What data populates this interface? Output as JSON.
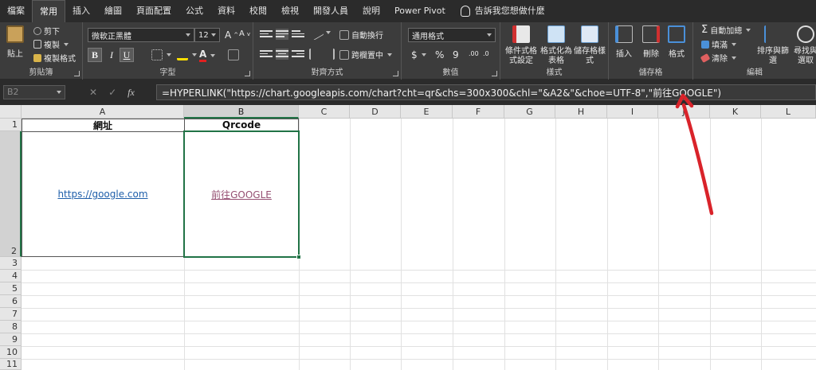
{
  "tabs": [
    "檔案",
    "常用",
    "插入",
    "繪圖",
    "頁面配置",
    "公式",
    "資料",
    "校閱",
    "檢視",
    "開發人員",
    "說明",
    "Power Pivot"
  ],
  "active_tab": "常用",
  "tell_me": "告訴我您想做什麼",
  "ribbon": {
    "clipboard": {
      "label": "剪貼簿",
      "paste": "貼上",
      "cut": "剪下",
      "copy": "複製",
      "format_painter": "複製格式"
    },
    "font": {
      "label": "字型",
      "font_name": "微軟正黑體",
      "font_size": "12",
      "grow": "A",
      "shrink": "A"
    },
    "alignment": {
      "label": "對齊方式",
      "wrap": "自動換行",
      "merge": "跨欄置中"
    },
    "number": {
      "label": "數值",
      "format": "通用格式",
      "currency": "$",
      "percent": "%",
      "comma": "9"
    },
    "styles": {
      "label": "樣式",
      "conditional": "條件式格式設定",
      "as_table": "格式化為表格",
      "cell_styles": "儲存格樣式"
    },
    "cells": {
      "label": "儲存格",
      "insert": "插入",
      "delete": "刪除",
      "format": "格式"
    },
    "editing": {
      "label": "編輯",
      "autosum": "自動加總",
      "fill": "填滿",
      "clear": "清除",
      "sort_filter": "排序與篩選",
      "find": "尋找與選取"
    }
  },
  "formula_bar": {
    "name_box": "B2",
    "fx": "fx",
    "formula": "=HYPERLINK(\"https://chart.googleapis.com/chart?cht=qr&chs=300x300&chl=\"&A2&\"&choe=UTF-8\",\"前往GOOGLE\")"
  },
  "columns": [
    "A",
    "B",
    "C",
    "D",
    "E",
    "F",
    "G",
    "H",
    "I",
    "J",
    "K",
    "L"
  ],
  "rows": [
    "1",
    "2",
    "3",
    "4",
    "5",
    "6",
    "7",
    "8",
    "9",
    "10",
    "11"
  ],
  "cells": {
    "A1": "網址",
    "B1": "Qrcode",
    "A2": "https://google.com",
    "B2": "前往GOOGLE"
  },
  "colors": {
    "accent": "#217346",
    "link": "#1f5faa",
    "visited_link": "#954f72",
    "annotation_arrow": "#d9232a"
  }
}
